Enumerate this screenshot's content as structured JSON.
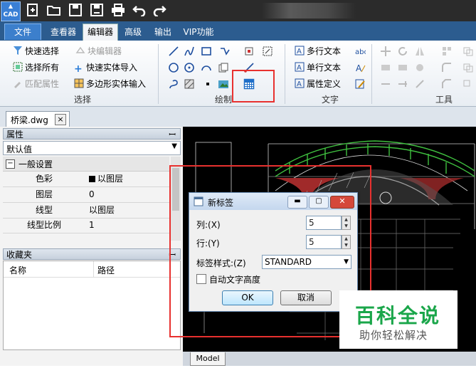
{
  "app": {
    "logo_text": "CAD"
  },
  "menu": {
    "tabs": [
      {
        "label": "文件"
      },
      {
        "label": "查看器"
      },
      {
        "label": "编辑器"
      },
      {
        "label": "高级"
      },
      {
        "label": "输出"
      },
      {
        "label": "VIP功能"
      }
    ]
  },
  "ribbon": {
    "select_group": {
      "label": "选择",
      "quick_select": "快速选择",
      "select_all": "选择所有",
      "match_props": "匹配属性",
      "block_editor": "块编辑器",
      "quick_import": "快速实体导入",
      "polygon_input": "多边形实体输入"
    },
    "draw_group": {
      "label": "绘制"
    },
    "text_group": {
      "label": "文字",
      "mtext": "多行文本",
      "stext": "单行文本",
      "attdef": "属性定义"
    },
    "tools_group": {
      "label": "工具"
    }
  },
  "document": {
    "tab_name": "桥梁.dwg",
    "close_symbol": "×"
  },
  "properties_panel": {
    "title": "属性",
    "pin": "ꟷ",
    "filter_value": "默认值",
    "section": "一般设置",
    "rows": [
      {
        "name": "色彩",
        "value": "以图层"
      },
      {
        "name": "图层",
        "value": "0"
      },
      {
        "name": "线型",
        "value": "以图层"
      },
      {
        "name": "线型比例",
        "value": "1"
      }
    ]
  },
  "favorites_panel": {
    "title": "收藏夹",
    "col_name": "名称",
    "col_path": "路径"
  },
  "model_tab": "Model",
  "dialog": {
    "title": "新标签",
    "cols_label": "列:(X)",
    "cols_value": "5",
    "rows_label": "行:(Y)",
    "rows_value": "5",
    "style_label": "标签样式:(Z)",
    "style_value": "STANDARD",
    "auto_height_label": "自动文字高度",
    "ok": "OK",
    "cancel": "取消"
  },
  "watermark": {
    "title": "百科全说",
    "subtitle": "助你轻松解决"
  },
  "colors": {
    "menubar": "#2c5c8f",
    "highlight": "#e8312f",
    "watermark_green": "#1aa64a"
  }
}
